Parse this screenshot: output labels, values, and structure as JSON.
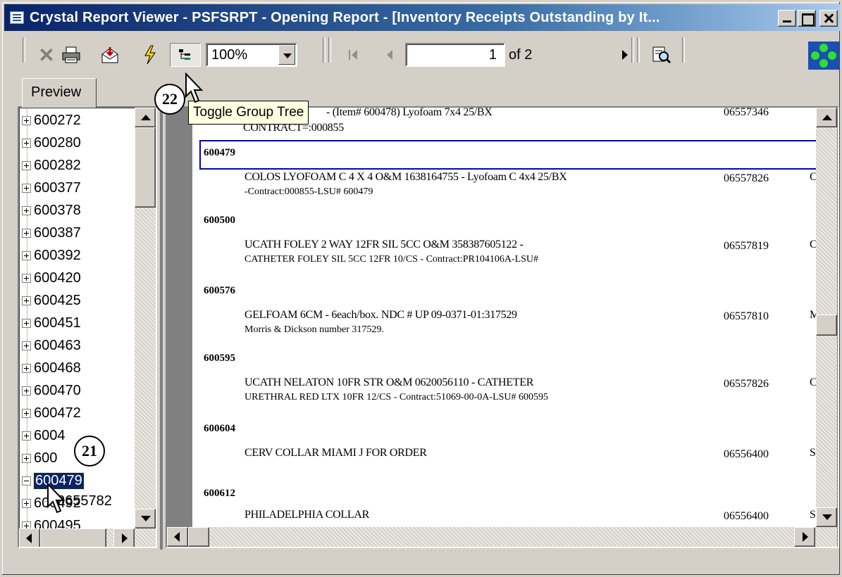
{
  "window": {
    "title": "Crystal Report Viewer - PSFSRPT - Opening Report - [Inventory Receipts Outstanding by It..."
  },
  "toolbar": {
    "zoom_value": "100%",
    "page_current": "1",
    "page_of": "of 2",
    "icons": [
      "close-icon",
      "print-icon",
      "export-icon",
      "refresh-icon",
      "group-tree-icon",
      "first-page-icon",
      "prev-page-icon",
      "next-page-icon",
      "search-icon",
      "logo-icon"
    ]
  },
  "tabs": {
    "preview_label": "Preview"
  },
  "tooltip": {
    "text": "Toggle Group Tree"
  },
  "callouts": {
    "c22": "22",
    "c21": "21"
  },
  "tree": {
    "items": [
      "600272",
      "600280",
      "600282",
      "600377",
      "600378",
      "600387",
      "600392",
      "600420",
      "600425",
      "600451",
      "600463",
      "600468",
      "600470",
      "600472",
      "600474",
      "600478",
      "600479",
      "600492",
      "600495"
    ],
    "visible_labels": [
      "600272",
      "600280",
      "600282",
      "600377",
      "600378",
      "600387",
      "600392",
      "600420",
      "600425",
      "600451",
      "600463",
      "600468",
      "600470",
      "600472",
      "6004",
      "600",
      "600479",
      "600492",
      "600495"
    ],
    "selected": "600479",
    "child_label": "0655782"
  },
  "report": {
    "top_partial_line1": "- (Item# 600478) Lyofoam 7x4  25/BX",
    "top_partial_line2": "CONTRACT=:000855",
    "top_partial_num": "06557346",
    "groups": [
      {
        "id": "600479",
        "line1": "COLOS LYOFOAM C 4 X 4  O&M 1638164755 - Lyofoam C 4x4 25/BX",
        "line2": "-Contract:000855-LSU# 600479",
        "num": "06557826",
        "clip": "C"
      },
      {
        "id": "600500",
        "line1": "UCATH FOLEY 2 WAY 12FR SIL  5CC O&M 358387605122 -",
        "line2": "CATHETER FOLEY SIL 5CC 12FR 10/CS - Contract:PR104106A-LSU#",
        "num": "06557819",
        "clip": "C"
      },
      {
        "id": "600576",
        "line1": "GELFOAM 6CM - 6each/box. NDC # UP 09-0371-01:317529",
        "line2": "Morris & Dickson number 317529.",
        "num": "06557810",
        "clip": "M"
      },
      {
        "id": "600595",
        "line1": "UCATH NELATON 10FR STR O&M 0620056110 - CATHETER",
        "line2": "URETHRAL RED LTX 10FR 12/CS - Contract:51069-00-0A-LSU# 600595",
        "num": "06557826",
        "clip": "C"
      },
      {
        "id": "600604",
        "line1": "CERV COLLAR MIAMI J FOR ORDER",
        "line2": "",
        "num": "06556400",
        "clip": "S"
      },
      {
        "id": "600612",
        "line1": "PHILADELPHIA COLLAR",
        "line2": "",
        "num": "06556400",
        "clip": "S"
      }
    ]
  },
  "colors": {
    "title_start": "#0a246a",
    "title_end": "#a6caf0",
    "selection": "#0a246a",
    "group_highlight": "#0000cc",
    "tooltip_bg": "#ffffe1"
  }
}
